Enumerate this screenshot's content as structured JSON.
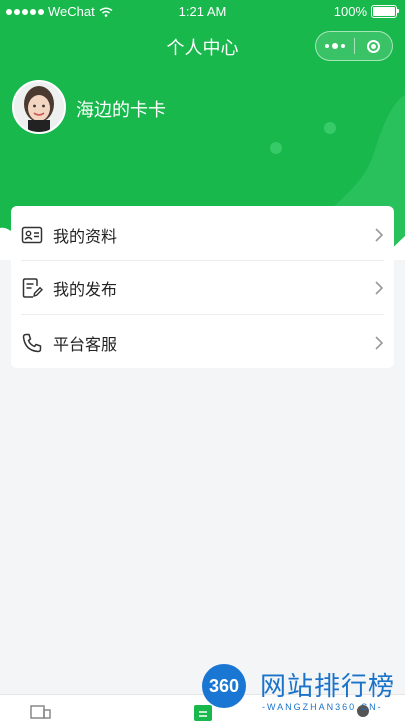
{
  "status_bar": {
    "carrier": "WeChat",
    "time": "1:21 AM",
    "battery": "100%"
  },
  "nav": {
    "title": "个人中心"
  },
  "profile": {
    "username": "海边的卡卡"
  },
  "menu": [
    {
      "label": "我的资料",
      "icon": "id-card-icon"
    },
    {
      "label": "我的发布",
      "icon": "edit-document-icon"
    },
    {
      "label": "平台客服",
      "icon": "phone-icon"
    }
  ],
  "watermark": {
    "logo": "360",
    "title": "网站排行榜",
    "subtitle": "-WANGZHAN360.CN-"
  },
  "colors": {
    "brand_green": "#18b84d",
    "background": "#f4f5f7",
    "watermark_blue": "#1a73c9"
  }
}
